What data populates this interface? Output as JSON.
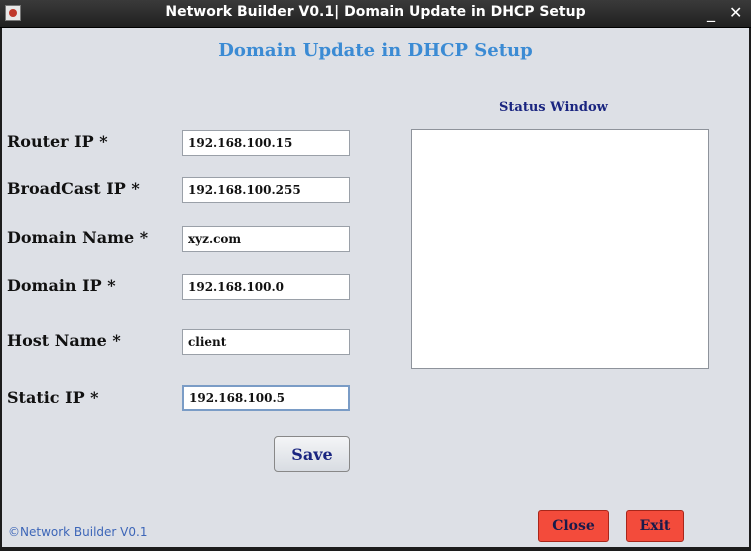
{
  "window": {
    "title": "Network Builder V0.1| Domain Update in DHCP Setup",
    "minimize": "_",
    "close": "✕"
  },
  "heading": "Domain Update in DHCP Setup",
  "status": {
    "title": "Status Window",
    "text": ""
  },
  "fields": [
    {
      "label": "Router IP *",
      "value": "192.168.100.15"
    },
    {
      "label": "BroadCast IP *",
      "value": "192.168.100.255"
    },
    {
      "label": "Domain Name *",
      "value": "xyz.com"
    },
    {
      "label": "Domain IP *",
      "value": "192.168.100.0"
    },
    {
      "label": "Host Name *",
      "value": "client"
    },
    {
      "label": "Static IP *",
      "value": "192.168.100.5"
    }
  ],
  "buttons": {
    "save": "Save",
    "close": "Close",
    "exit": "Exit"
  },
  "footer": "©Network Builder V0.1",
  "colors": {
    "heading": "#3b8bd4",
    "red_button": "#f34b3b",
    "panel": "#dde0e6"
  },
  "icons": {
    "app": "app-logo-icon"
  }
}
